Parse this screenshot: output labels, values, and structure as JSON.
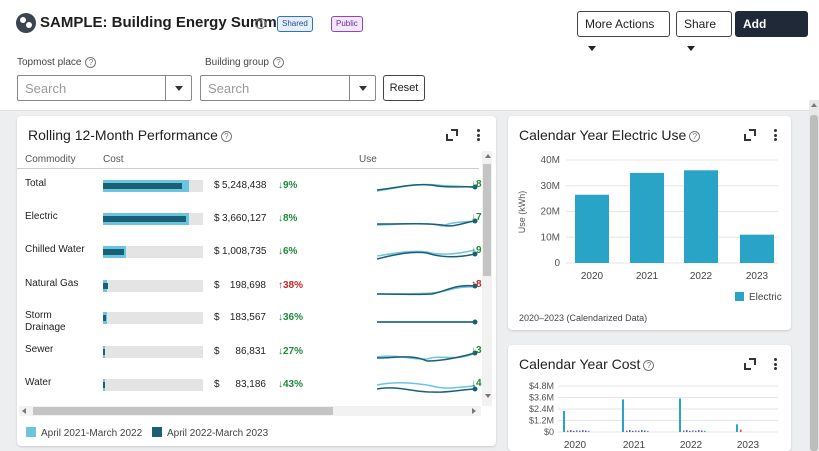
{
  "header": {
    "title": "SAMPLE: Building Energy Summary",
    "badge_shared": "Shared",
    "badge_public": "Public",
    "more_actions": "More Actions",
    "share": "Share",
    "add_widget": "Add Widget"
  },
  "filters": {
    "topmost_label": "Topmost place",
    "topmost_placeholder": "Search",
    "group_label": "Building group",
    "group_placeholder": "Search",
    "reset": "Reset"
  },
  "performance": {
    "title": "Rolling 12-Month Performance",
    "col_commodity": "Commodity",
    "col_cost": "Cost",
    "col_use": "Use",
    "rows": [
      {
        "name": "Total",
        "dollar": "$",
        "cost": "5,248,438",
        "pct": "↓9%",
        "dir": "down",
        "end": "↓8",
        "prev": 0.86,
        "cur": 0.79
      },
      {
        "name": "Electric",
        "dollar": "$",
        "cost": "3,660,127",
        "pct": "↓8%",
        "dir": "down",
        "end": "↓7",
        "prev": 0.86,
        "cur": 0.83
      },
      {
        "name": "Chilled Water",
        "dollar": "$",
        "cost": "1,008,735",
        "pct": "↓6%",
        "dir": "down",
        "end": "↓9",
        "prev": 0.23,
        "cur": 0.21
      },
      {
        "name": "Natural Gas",
        "dollar": "$",
        "cost": "198,698",
        "pct": "↑38%",
        "dir": "up",
        "end": "↑8",
        "prev": 0.04,
        "cur": 0.05
      },
      {
        "name": "Storm Drainage",
        "dollar": "$",
        "cost": "183,567",
        "pct": "↓36%",
        "dir": "down",
        "end": "",
        "prev": 0.04,
        "cur": 0.03
      },
      {
        "name": "Sewer",
        "dollar": "$",
        "cost": "86,831",
        "pct": "↓27%",
        "dir": "down",
        "end": "↓3",
        "prev": 0.02,
        "cur": 0.015
      },
      {
        "name": "Water",
        "dollar": "$",
        "cost": "83,186",
        "pct": "↓43%",
        "dir": "down",
        "end": "↓4",
        "prev": 0.02,
        "cur": 0.012
      }
    ],
    "legend_prev": "April 2021-March 2022",
    "legend_cur": "April 2022-March 2023",
    "color_prev": "#6cc5e0",
    "color_cur": "#1a6075"
  },
  "electric_chart": {
    "title": "Calendar Year Electric Use",
    "note": "2020–2023 (Calendarized Data)"
  },
  "cost_chart": {
    "title": "Calendar Year Cost"
  },
  "chart_data": [
    {
      "type": "bar",
      "title": "Calendar Year Electric Use",
      "categories": [
        "2020",
        "2021",
        "2022",
        "2023"
      ],
      "series": [
        {
          "name": "Electric",
          "values": [
            26.5,
            35,
            36,
            11
          ]
        }
      ],
      "ylabel": "Use (kWh)",
      "ylim": [
        0,
        40
      ],
      "yticks": [
        "0",
        "10M",
        "20M",
        "30M",
        "40M"
      ],
      "color": "#29a3c6",
      "legend": "bottom-right",
      "grid": true
    },
    {
      "type": "bar",
      "title": "Calendar Year Cost",
      "categories": [
        "2020",
        "2021",
        "2022",
        "2023"
      ],
      "yticks": [
        "$0",
        "$1.2M",
        "$2.4M",
        "$3.6M",
        "$4.8M"
      ],
      "ylim": [
        0,
        4.8
      ],
      "grid": true
    }
  ]
}
